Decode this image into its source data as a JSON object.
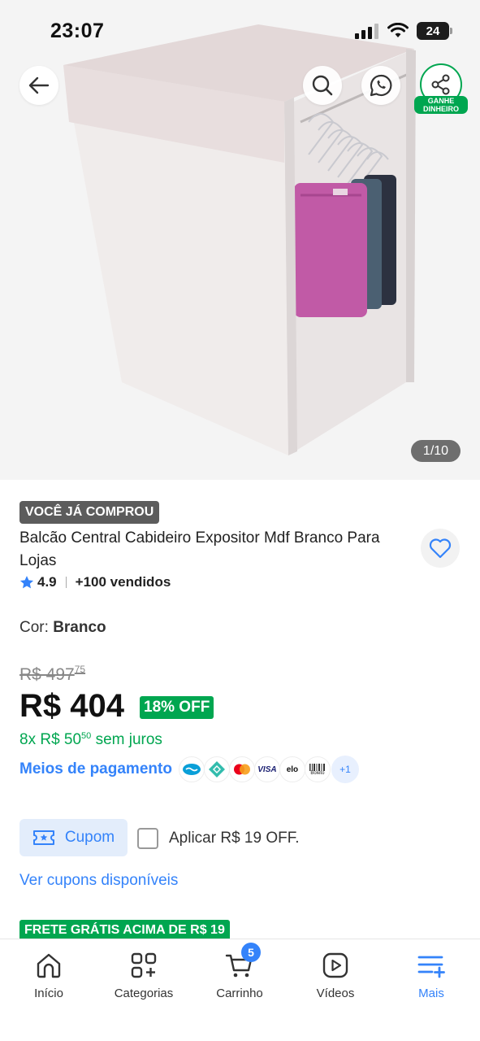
{
  "status_bar": {
    "time": "23:07",
    "battery": "24"
  },
  "gallery": {
    "counter": "1/10"
  },
  "header": {
    "share_badge_line1": "GANHE",
    "share_badge_line2": "DINHEIRO"
  },
  "product": {
    "bought_badge": "VOCÊ JÁ COMPROU",
    "title": "Balcão Central Cabideiro Expositor Mdf Branco Para Lojas",
    "rating": "4.9",
    "sold": "+100 vendidos",
    "color_label": "Cor:",
    "color_value": "Branco",
    "old_price_main": "R$ 497",
    "old_price_cents": "75",
    "price": "R$ 404",
    "discount": "18% OFF",
    "installments_prefix": "8x R$ 50",
    "installments_cents": "50",
    "installments_suffix": "sem juros",
    "payment_label": "Meios de pagamento",
    "payment_methods": [
      "mercado-pago",
      "pix",
      "mastercard",
      "visa",
      "elo",
      "boleto"
    ],
    "visa_text": "VISA",
    "elo_text": "elo",
    "boleto_text": "Boleto",
    "payment_more": "+1"
  },
  "coupon": {
    "button_label": "Cupom",
    "apply_text": "Aplicar R$ 19 OFF.",
    "link": "Ver cupons disponíveis"
  },
  "shipping": {
    "banner": "FRETE GRÁTIS ACIMA DE R$ 19"
  },
  "nav": {
    "items": [
      {
        "label": "Início",
        "icon": "home-icon"
      },
      {
        "label": "Categorias",
        "icon": "categories-icon"
      },
      {
        "label": "Carrinho",
        "icon": "cart-icon",
        "badge": "5"
      },
      {
        "label": "Vídeos",
        "icon": "video-icon"
      },
      {
        "label": "Mais",
        "icon": "menu-icon",
        "active": true
      }
    ]
  },
  "colors": {
    "accent": "#3483fa",
    "green": "#00a650"
  }
}
